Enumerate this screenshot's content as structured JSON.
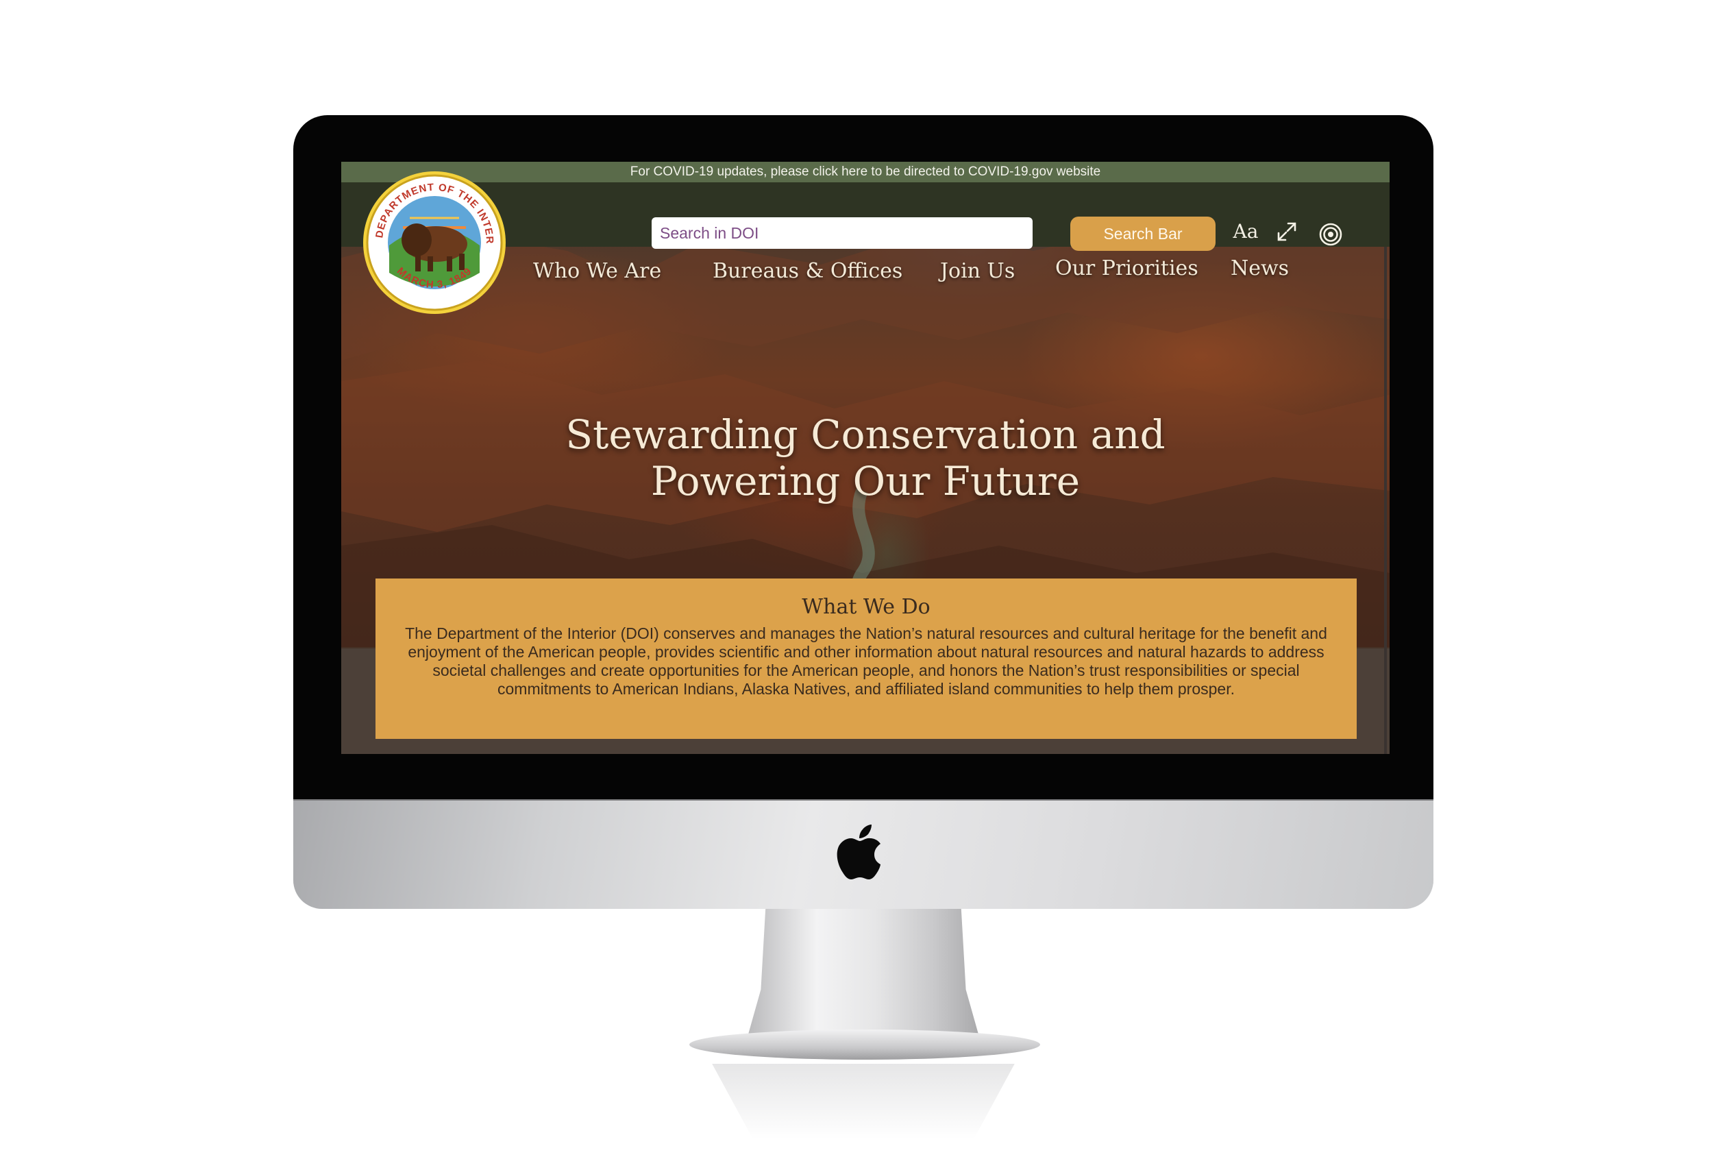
{
  "site": {
    "seal_text_top": "U.S. DEPARTMENT OF THE INTERIOR",
    "seal_text_bottom": "MARCH 3, 1849"
  },
  "banner": {
    "text": "For COVID-19 updates, please click here to be directed to COVID-19.gov website"
  },
  "header": {
    "search_placeholder": "Search in DOI",
    "search_button": "Search Bar",
    "font_size_label": "Aa",
    "expand_icon": "expand-icon",
    "accessibility_icon": "accessibility-icon"
  },
  "nav": {
    "items": [
      {
        "label": "Who We Are"
      },
      {
        "label": "Bureaus & Offices"
      },
      {
        "label": "Join Us"
      },
      {
        "label": "Our Priorities"
      },
      {
        "label": "News"
      }
    ]
  },
  "hero": {
    "title_line1": "Stewarding Conservation and",
    "title_line2": "Powering Our Future"
  },
  "what_we_do": {
    "heading": "What We Do",
    "body": "The Department of the Interior (DOI) conserves and manages the Nation’s natural resources and cultural heritage for the benefit and enjoyment of the American people, provides scientific and other information about natural resources and natural hazards to address societal challenges and create opportunities for the American people, and honors the Nation’s trust responsibilities or special commitments to American Indians, Alaska Natives, and affiliated island communities to help them prosper."
  },
  "colors": {
    "banner_bg": "#5a6b4a",
    "header_bg": "#2e3423",
    "accent": "#dca24b",
    "text_light": "#f3ead8",
    "text_dark": "#3a2b1e"
  }
}
